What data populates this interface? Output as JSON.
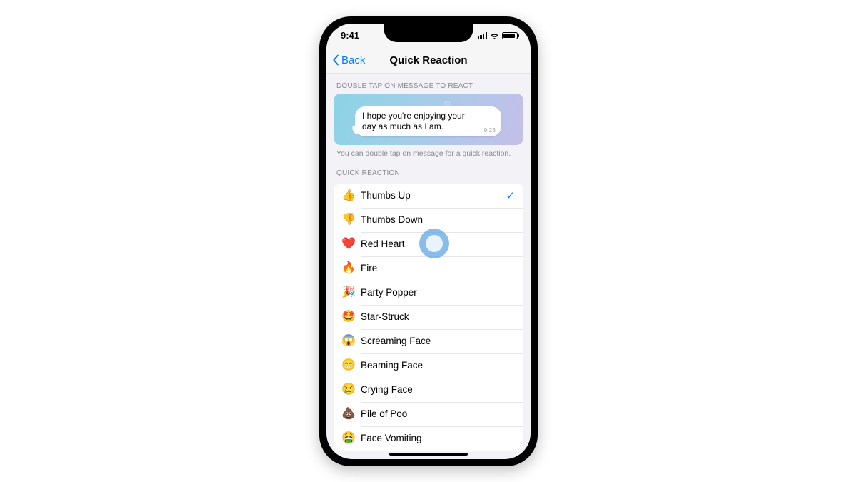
{
  "status": {
    "time": "9:41"
  },
  "nav": {
    "back": "Back",
    "title": "Quick Reaction"
  },
  "preview": {
    "header": "DOUBLE TAP ON MESSAGE TO REACT",
    "message": "I hope you're enjoying your day as much as I am.",
    "time": "9:23",
    "footer": "You can double tap on message for a quick reaction."
  },
  "list": {
    "header": "QUICK REACTION",
    "items": [
      {
        "emoji": "👍",
        "label": "Thumbs Up",
        "selected": true
      },
      {
        "emoji": "👎",
        "label": "Thumbs Down",
        "selected": false
      },
      {
        "emoji": "❤️",
        "label": "Red Heart",
        "selected": false
      },
      {
        "emoji": "🔥",
        "label": "Fire",
        "selected": false
      },
      {
        "emoji": "🎉",
        "label": "Party Popper",
        "selected": false
      },
      {
        "emoji": "🤩",
        "label": "Star-Struck",
        "selected": false
      },
      {
        "emoji": "😱",
        "label": "Screaming Face",
        "selected": false
      },
      {
        "emoji": "😁",
        "label": "Beaming Face",
        "selected": false
      },
      {
        "emoji": "😢",
        "label": "Crying Face",
        "selected": false
      },
      {
        "emoji": "💩",
        "label": "Pile of Poo",
        "selected": false
      },
      {
        "emoji": "🤮",
        "label": "Face Vomiting",
        "selected": false
      }
    ]
  },
  "tap_indicator_row": 2
}
